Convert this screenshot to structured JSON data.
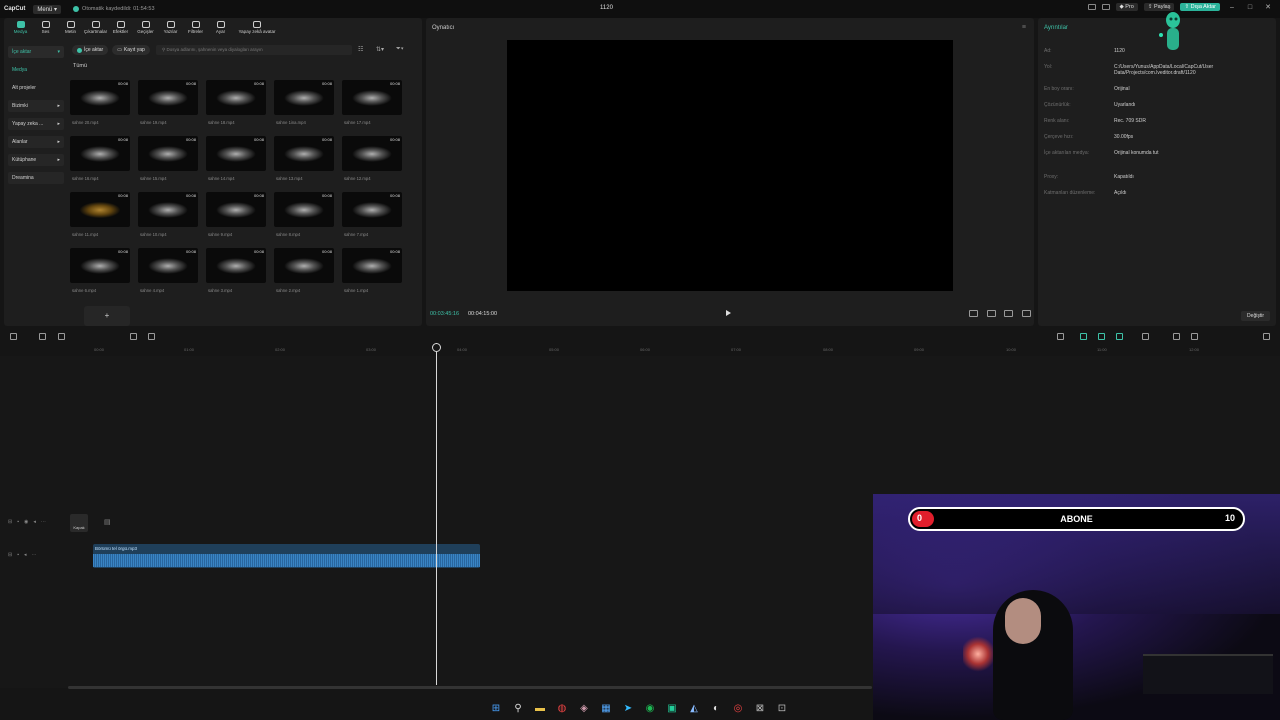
{
  "titlebar": {
    "logo": "CapCut",
    "menu": "Menü",
    "autosave": "Otomatik kaydedildi: 01:54:53",
    "project_title": "1120",
    "pro": "Pro",
    "share": "Paylaş",
    "export": "Dışa Aktar"
  },
  "toolbar": {
    "items": [
      {
        "label": "Medya",
        "icon": "media-icon"
      },
      {
        "label": "Ses",
        "icon": "audio-icon"
      },
      {
        "label": "Metin",
        "icon": "text-icon"
      },
      {
        "label": "Çıkartmalar",
        "icon": "sticker-icon"
      },
      {
        "label": "Efektler",
        "icon": "effects-icon"
      },
      {
        "label": "Geçişler",
        "icon": "transitions-icon"
      },
      {
        "label": "Yazılar",
        "icon": "captions-icon"
      },
      {
        "label": "Filtreler",
        "icon": "filters-icon"
      },
      {
        "label": "Ayar",
        "icon": "adjust-icon"
      },
      {
        "label": "Yapay zekâ avatar",
        "icon": "ai-avatar-icon"
      }
    ]
  },
  "sidebar": {
    "items": [
      {
        "label": "İçe aktar",
        "arrow": "▾"
      },
      {
        "label": "Medya",
        "arrow": ""
      },
      {
        "label": "Alt projeler",
        "arrow": ""
      },
      {
        "label": "Bizimki",
        "arrow": "▸"
      },
      {
        "label": "Yapay zeka ...",
        "arrow": "▸"
      },
      {
        "label": "Alanlar",
        "arrow": "▸"
      },
      {
        "label": "Kütüphane",
        "arrow": "▸"
      },
      {
        "label": "Dreamina",
        "arrow": ""
      }
    ]
  },
  "media": {
    "import_btn": "İçe aktar",
    "record_btn": "Kayıt yap",
    "search_placeholder": "Dosya adlarını, şahnenin veya diyalogları arayın",
    "all_label": "Tümü",
    "add_label": "+",
    "items": [
      {
        "name": "sahne 20.mp4",
        "dur": "00:08"
      },
      {
        "name": "sahne 19.mp4",
        "dur": "00:08"
      },
      {
        "name": "sahne 18.mp4",
        "dur": "00:08"
      },
      {
        "name": "sahne 1ina.mp4",
        "dur": "00:08"
      },
      {
        "name": "sahne 17.mp4",
        "dur": "00:08"
      },
      {
        "name": "sahne 16.mp4",
        "dur": "00:08"
      },
      {
        "name": "sahne 15.mp4",
        "dur": "00:08"
      },
      {
        "name": "sahne 14.mp4",
        "dur": "00:08"
      },
      {
        "name": "sahne 13.mp4",
        "dur": "00:08"
      },
      {
        "name": "sahne 12.mp4",
        "dur": "00:08"
      },
      {
        "name": "sahne 11.mp4",
        "dur": "00:08"
      },
      {
        "name": "sahne 10.mp4",
        "dur": "00:08"
      },
      {
        "name": "sahne 9.mp4",
        "dur": "00:08"
      },
      {
        "name": "sahne 8.mp4",
        "dur": "00:08"
      },
      {
        "name": "sahne 7.mp4",
        "dur": "00:08"
      },
      {
        "name": "sahne 6.mp4",
        "dur": "00:08"
      },
      {
        "name": "sahne 4.mp4",
        "dur": "00:08"
      },
      {
        "name": "sahne 3.mp4",
        "dur": "00:08"
      },
      {
        "name": "sahne 2.mp4",
        "dur": "00:08"
      },
      {
        "name": "sahne 1.mp4",
        "dur": "00:08"
      }
    ]
  },
  "player": {
    "title": "Oynatıcı",
    "current_time": "00:03:45:16",
    "total_time": "00:04:15:00"
  },
  "details": {
    "title": "Ayrıntılar",
    "rows": [
      {
        "k": "Ad:",
        "v": "1120"
      },
      {
        "k": "Yol:",
        "v": "C:/Users/Yunus/AppData/Local/CapCut/User Data/Projects/com.lveditor.draft/1120"
      },
      {
        "k": "En boy oranı:",
        "v": "Orijinal"
      },
      {
        "k": "Çözünürlük:",
        "v": "Uyarlandı"
      },
      {
        "k": "Renk alanı:",
        "v": "Rec. 709 SDR"
      },
      {
        "k": "Çerçeve hızı:",
        "v": "30.00fps"
      },
      {
        "k": "İçe aktarılan medya:",
        "v": "Orijinal konumda tut"
      },
      {
        "k": "Proxy:",
        "v": "Kapatıldı"
      },
      {
        "k": "Katmanları düzenleme:",
        "v": "Açıldı"
      }
    ],
    "change_btn": "Değiştir"
  },
  "timeline": {
    "ticks": [
      "00:00",
      "01:00",
      "02:00",
      "03:00",
      "04:00",
      "05:00",
      "06:00",
      "07:00",
      "08:00",
      "09:00",
      "10:00",
      "11:00",
      "12:00"
    ],
    "cover_label": "Kapak",
    "audio_clip_name": "Börümü tel örgü.mp3"
  },
  "stream_overlay": {
    "goal_label": "ABONE",
    "start": "0",
    "end": "10",
    "progress": 0
  },
  "colors": {
    "accent": "#3ec2a8",
    "panel": "#1e1e1e",
    "audio_clip": "#1f3f5a",
    "goal_red": "#e01e2c"
  }
}
